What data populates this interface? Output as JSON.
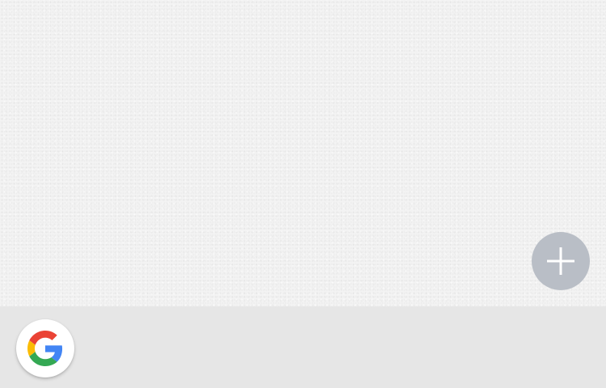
{
  "screen": {
    "background_color": "#f3f3f3",
    "bottom_bar_color": "#e6e6e6"
  },
  "add_button": {
    "icon": "plus-icon",
    "color": "#b9bec6",
    "icon_color": "#ffffff"
  },
  "google_button": {
    "icon": "google-g-logo",
    "colors": {
      "blue": "#4285F4",
      "red": "#EA4335",
      "yellow": "#FBBC05",
      "green": "#34A853"
    }
  }
}
